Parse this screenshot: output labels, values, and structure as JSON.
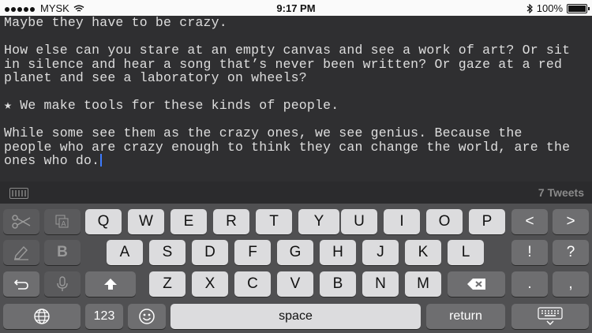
{
  "status_bar": {
    "carrier": "MYSK",
    "time": "9:17 PM",
    "battery": "100%"
  },
  "editor": {
    "lines": [
      "Maybe they have to be crazy.",
      "",
      "How else can you stare at an empty canvas and see a work of art? Or sit",
      "in silence and hear a song that’s never been written? Or gaze at a red",
      "planet and see a laboratory on wheels?",
      "",
      "★ We make tools for these kinds of people.",
      "",
      "While some see them as the crazy ones, we see genius. Because the",
      "people who are crazy enough to think they can change the world, are the",
      "ones who do."
    ]
  },
  "accessory_bar": {
    "tweet_count": "7 Tweets"
  },
  "keyboard": {
    "row1": [
      "Q",
      "W",
      "E",
      "R",
      "T",
      "Y",
      "U",
      "I",
      "O",
      "P"
    ],
    "row1_right": [
      "<",
      ">"
    ],
    "bold": "B",
    "row2": [
      "A",
      "S",
      "D",
      "F",
      "G",
      "H",
      "J",
      "K",
      "L"
    ],
    "row2_right": [
      "!",
      "?"
    ],
    "row3": [
      "Z",
      "X",
      "C",
      "V",
      "B",
      "N",
      "M"
    ],
    "row3_right": [
      ".",
      ","
    ],
    "numbers_label": "123",
    "space_label": "space",
    "return_label": "return"
  }
}
